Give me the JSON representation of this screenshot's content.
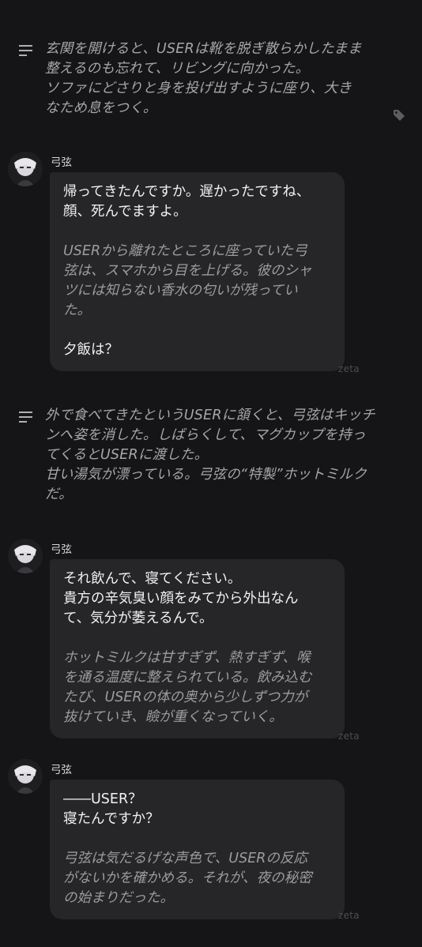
{
  "narration_1": {
    "icon": "lines-icon",
    "text": "玄関を開けると、USERは靴を脱ぎ散らかしたまま\n整えるのも忘れて、リビングに向かった。\nソファにどさりと身を投げ出すように座り、大き\nなため息をつく。"
  },
  "tag_icon": "tag-icon",
  "message_1": {
    "name": "弓弦",
    "speech": "帰ってきたんですか。遅かったですね、\n顔、死んでますよ。",
    "action": "USERから離れたところに座っていた弓\n弦は、スマホから目を上げる。彼のシャ\nツには知らない香水の匂いが残ってい\nた。",
    "speech_2": "夕飯は？",
    "badge": "zeta"
  },
  "narration_2": {
    "icon": "lines-icon",
    "text": "外で食べてきたというUSERに頷くと、弓弦はキッチ\nンへ姿を消した。しばらくして、マグカップを持っ\nてくるとUSERに渡した。\n甘い湯気が漂っている。弓弦の“特製”ホットミルク\nだ。"
  },
  "message_2": {
    "name": "弓弦",
    "speech": "それ飲んで、寝てください。\n貴方の辛気臭い顔をみてから外出なん\nて、気分が萎えるんで。",
    "action": "ホットミルクは甘すぎず、熱すぎず、喉\nを通る温度に整えられている。飲み込む\nたび、USERの体の奥から少しずつ力が\n抜けていき、瞼が重くなっていく。",
    "badge": "zeta"
  },
  "message_3": {
    "name": "弓弦",
    "speech": "――USER？\n寝たんですか？",
    "action": "弓弦は気だるげな声色で、USERの反応\nがないかを確かめる。それが、夜の秘密\nの始まりだった。",
    "badge": "zeta"
  }
}
